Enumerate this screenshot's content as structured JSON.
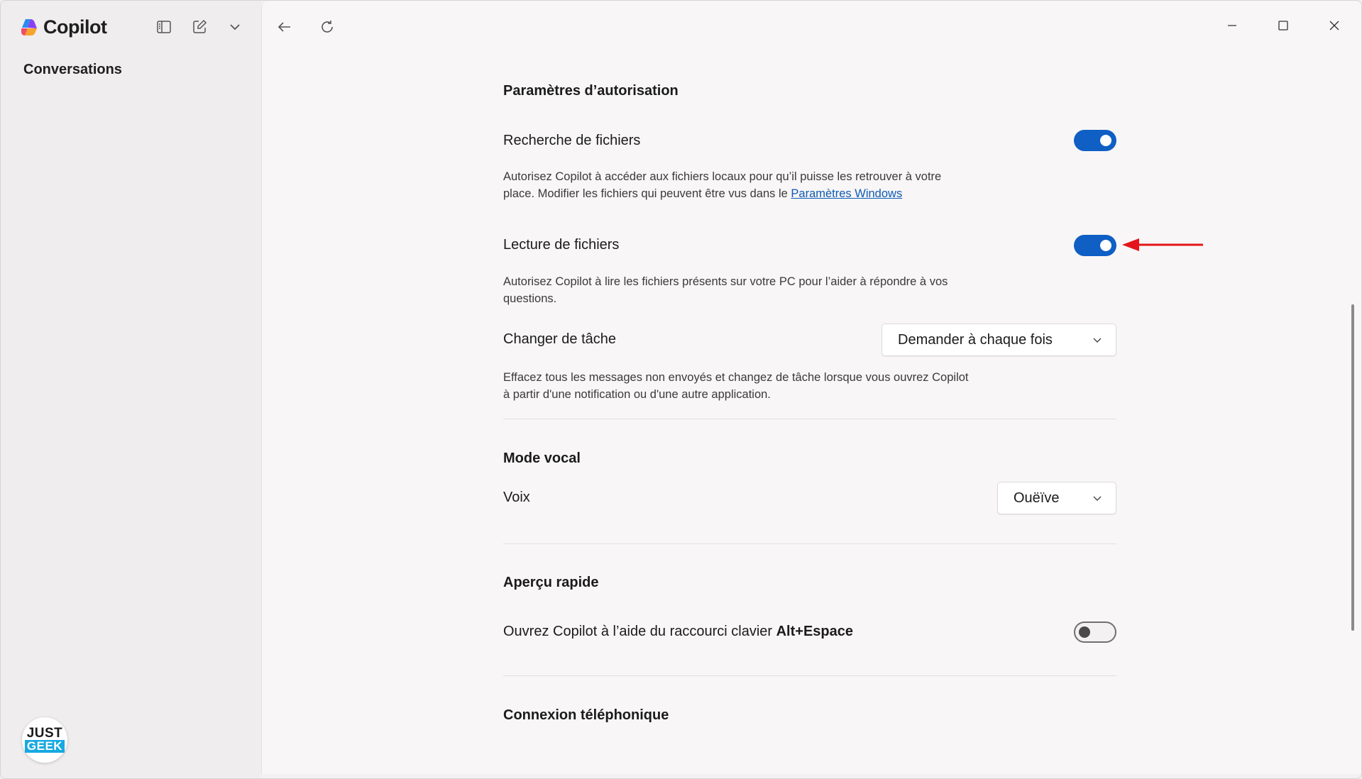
{
  "app": {
    "name": "Copilot"
  },
  "sidebar": {
    "title": "Conversations"
  },
  "watermark": {
    "line1": "JUST",
    "line2": "GEEK"
  },
  "settings": {
    "permissions": {
      "title": "Paramètres d’autorisation",
      "file_search": {
        "label": "Recherche de fichiers",
        "enabled": true,
        "description": "Autorisez Copilot à accéder aux fichiers locaux pour qu’il puisse les retrouver à votre place. Modifier les fichiers qui peuvent être vus dans le ",
        "link": "Paramètres Windows"
      },
      "file_reading": {
        "label": "Lecture de fichiers",
        "enabled": true,
        "description": "Autorisez Copilot à lire les fichiers présents sur votre PC pour l’aider à répondre à vos questions."
      },
      "task_switch": {
        "label": "Changer de tâche",
        "value": "Demander à chaque fois",
        "description": "Effacez tous les messages non envoyés et changez de tâche lorsque vous ouvrez Copilot à partir d'une notification ou d'une autre application."
      }
    },
    "voice": {
      "title": "Mode vocal",
      "voice_label": "Voix",
      "voice_value": "Ouëïve"
    },
    "quick_view": {
      "title": "Aperçu rapide",
      "label_prefix": "Ouvrez Copilot à l’aide du raccourci clavier ",
      "shortcut": "Alt+Espace",
      "enabled": false
    },
    "phone": {
      "title": "Connexion téléphonique"
    }
  },
  "colors": {
    "accent": "#0f5fc4",
    "annotation_arrow": "#e3161b"
  }
}
